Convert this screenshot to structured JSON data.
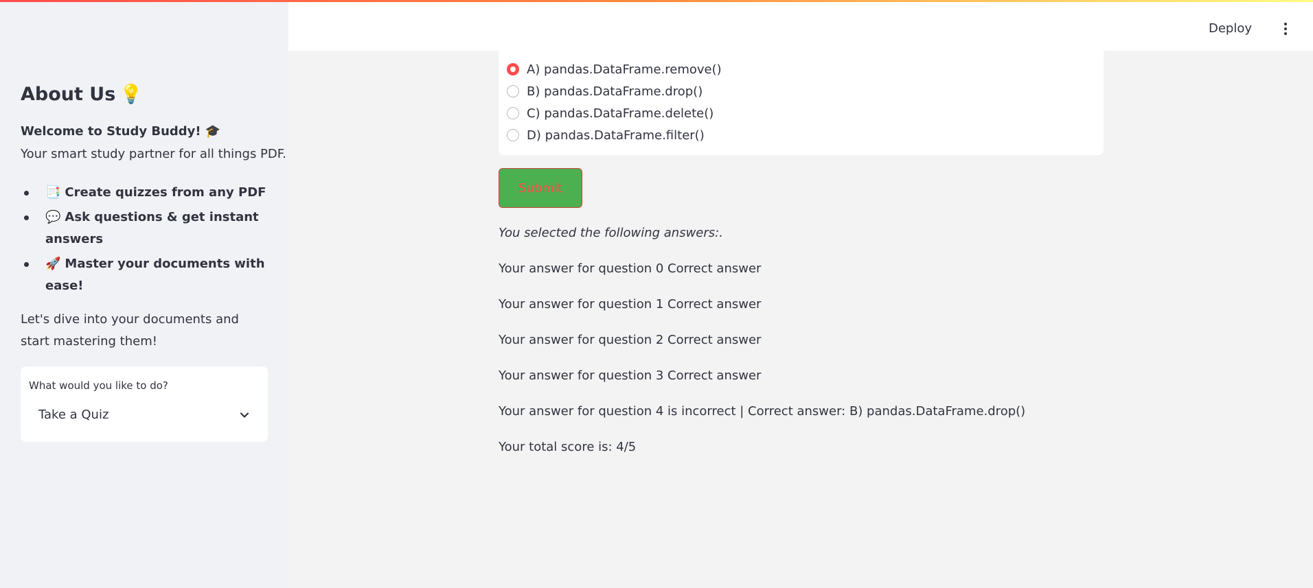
{
  "sidebar": {
    "title": "About Us",
    "title_emoji": "💡",
    "welcome": "Welcome to Study Buddy!",
    "welcome_emoji": "🎓",
    "tagline": "Your smart study partner for all things PDF.",
    "features": [
      {
        "emoji": "📑",
        "text": "Create quizzes from any PDF"
      },
      {
        "emoji": "💬",
        "text": "Ask questions & get instant answers"
      },
      {
        "emoji": "🚀",
        "text": "Master your documents with ease!"
      }
    ],
    "outro": "Let's dive into your documents and start mastering them!",
    "select_label": "What would you like to do?",
    "select_value": "Take a Quiz"
  },
  "header": {
    "deploy_label": "Deploy"
  },
  "quiz": {
    "options": [
      {
        "label": "A) pandas.DataFrame.remove()",
        "checked": true
      },
      {
        "label": "B) pandas.DataFrame.drop()",
        "checked": false
      },
      {
        "label": "C) pandas.DataFrame.delete()",
        "checked": false
      },
      {
        "label": "D) pandas.DataFrame.filter()",
        "checked": false
      }
    ],
    "submit_label": "Submit"
  },
  "results": {
    "intro": "You selected the following answers:.",
    "lines": [
      "Your answer for question 0 Correct answer",
      "Your answer for question 1 Correct answer",
      "Your answer for question 2 Correct answer",
      "Your answer for question 3 Correct answer",
      "Your answer for question 4 is incorrect | Correct answer: B) pandas.DataFrame.drop()"
    ],
    "score": "Your total score is: 4/5"
  },
  "colors": {
    "accent": "#ff4b4b",
    "submit_bg": "#4caf50",
    "sidebar_bg": "#f0f2f6",
    "main_bg": "#f3f3f4"
  }
}
